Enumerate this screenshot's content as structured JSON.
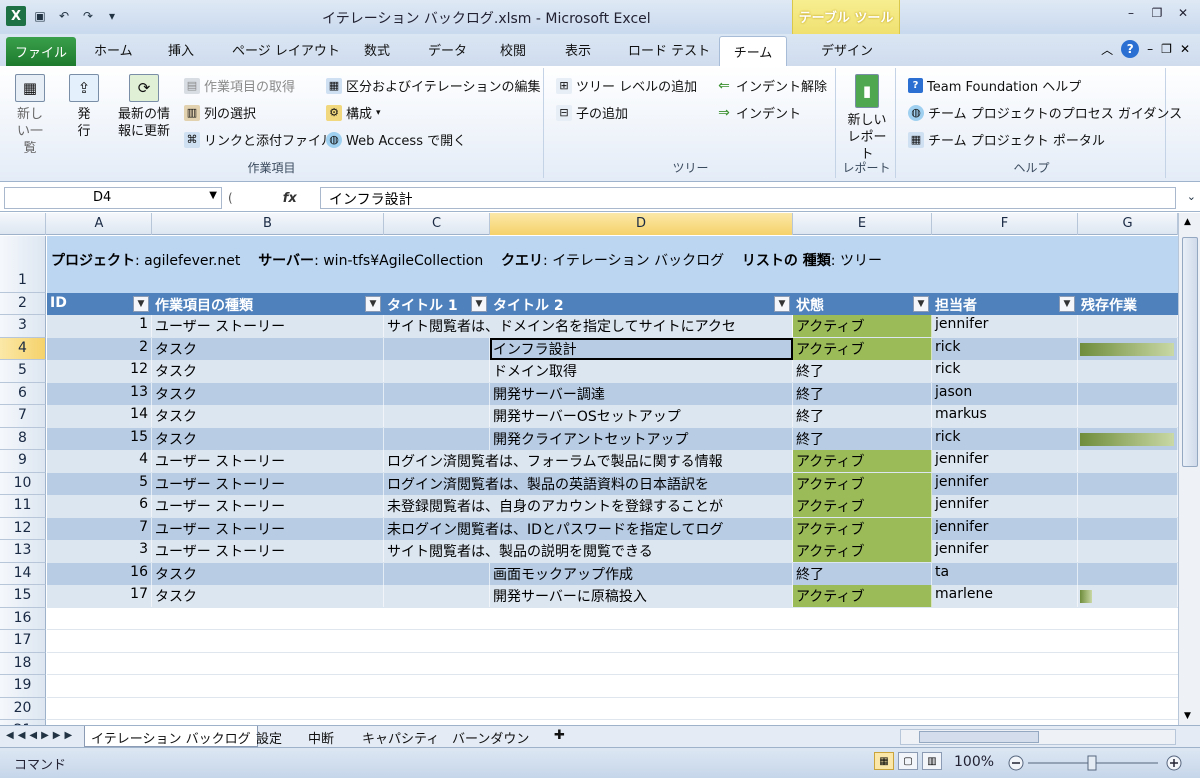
{
  "window": {
    "title": "イテレーション バックログ.xlsm  -  Microsoft Excel",
    "context_tab": "テーブル ツール"
  },
  "ribbon_tabs": [
    "ファイル",
    "ホーム",
    "挿入",
    "ページ レイアウト",
    "数式",
    "データ",
    "校閲",
    "表示",
    "ロード テスト",
    "チーム",
    "デザイン"
  ],
  "ribbon": {
    "workitems": {
      "new_list": "新しい一覧",
      "publish": "発行",
      "refresh": "最新の情報に更新",
      "get_workitems": "作業項目の取得",
      "choose_columns": "列の選択",
      "links": "リンクと添付ファイル",
      "edit_areas": "区分およびイテレーションの編集",
      "configure": "構成",
      "web_access": "Web Access で開く",
      "label": "作業項目"
    },
    "tree": {
      "add_tree_level": "ツリー レベルの追加",
      "add_child": "子の追加",
      "outdent": "インデント解除",
      "indent": "インデント",
      "label": "ツリー"
    },
    "reports": {
      "new_report": "新しいレポート",
      "label": "レポート"
    },
    "help": {
      "tf_help": "Team Foundation ヘルプ",
      "process_guidance": "チーム プロジェクトのプロセス ガイダンス",
      "portal": "チーム プロジェクト ポータル",
      "label": "ヘルプ"
    }
  },
  "formula_bar": {
    "name_box": "D4",
    "fx": "fx",
    "formula": "インフラ設計"
  },
  "columns": [
    "A",
    "B",
    "C",
    "D",
    "E",
    "F",
    "G"
  ],
  "row1": {
    "project_label": "プロジェクト",
    "project": ": agilefever.net",
    "server_label": "サーバー",
    "server": ": win-tfs¥AgileCollection",
    "query_label": "クエリ",
    "query": ": イテレーション バックログ",
    "listtype_label": "リストの 種類",
    "listtype": ": ツリー"
  },
  "table_headers": [
    "ID",
    "作業項目の種類",
    "タイトル 1",
    "タイトル 2",
    "状態",
    "担当者",
    "残存作業"
  ],
  "rows": [
    {
      "id": "1",
      "type": "ユーザー ストーリー",
      "t1": "サイト閲覧者は、ドメイン名を指定してサイトにアクセ",
      "t2": "",
      "state": "アクティブ",
      "owner": "jennifer",
      "remaining": 0
    },
    {
      "id": "2",
      "type": "タスク",
      "t1": "",
      "t2": "インフラ設計",
      "state": "アクティブ",
      "owner": "rick",
      "remaining": 0.98
    },
    {
      "id": "12",
      "type": "タスク",
      "t1": "",
      "t2": "ドメイン取得",
      "state": "終了",
      "owner": "rick",
      "remaining": 0
    },
    {
      "id": "13",
      "type": "タスク",
      "t1": "",
      "t2": "開発サーバー調達",
      "state": "終了",
      "owner": "jason",
      "remaining": 0
    },
    {
      "id": "14",
      "type": "タスク",
      "t1": "",
      "t2": "開発サーバーOSセットアップ",
      "state": "終了",
      "owner": "markus",
      "remaining": 0
    },
    {
      "id": "15",
      "type": "タスク",
      "t1": "",
      "t2": "開発クライアントセットアップ",
      "state": "終了",
      "owner": "rick",
      "remaining": 0.98
    },
    {
      "id": "4",
      "type": "ユーザー ストーリー",
      "t1": "ログイン済閲覧者は、フォーラムで製品に関する情報",
      "t2": "",
      "state": "アクティブ",
      "owner": "jennifer",
      "remaining": 0
    },
    {
      "id": "5",
      "type": "ユーザー ストーリー",
      "t1": "ログイン済閲覧者は、製品の英語資料の日本語訳を",
      "t2": "",
      "state": "アクティブ",
      "owner": "jennifer",
      "remaining": 0
    },
    {
      "id": "6",
      "type": "ユーザー ストーリー",
      "t1": "未登録閲覧者は、自身のアカウントを登録することが",
      "t2": "",
      "state": "アクティブ",
      "owner": "jennifer",
      "remaining": 0
    },
    {
      "id": "7",
      "type": "ユーザー ストーリー",
      "t1": "未ログイン閲覧者は、IDとパスワードを指定してログ",
      "t2": "",
      "state": "アクティブ",
      "owner": "jennifer",
      "remaining": 0
    },
    {
      "id": "3",
      "type": "ユーザー ストーリー",
      "t1": "サイト閲覧者は、製品の説明を閲覧できる",
      "t2": "",
      "state": "アクティブ",
      "owner": "jennifer",
      "remaining": 0
    },
    {
      "id": "16",
      "type": "タスク",
      "t1": "",
      "t2": "画面モックアップ作成",
      "state": "終了",
      "owner": "ta",
      "remaining": 0
    },
    {
      "id": "17",
      "type": "タスク",
      "t1": "",
      "t2": "開発サーバーに原稿投入",
      "state": "アクティブ",
      "owner": "marlene",
      "remaining": 0.12
    }
  ],
  "row_numbers": [
    "1",
    "2",
    "3",
    "4",
    "5",
    "6",
    "7",
    "8",
    "9",
    "10",
    "11",
    "12",
    "13",
    "14",
    "15",
    "16",
    "17",
    "18",
    "19",
    "20",
    "21"
  ],
  "sheets": [
    "イテレーション バックログ",
    "設定",
    "中断",
    "キャパシティ",
    "バーンダウン"
  ],
  "status": {
    "mode": "コマンド",
    "zoom": "100%"
  }
}
